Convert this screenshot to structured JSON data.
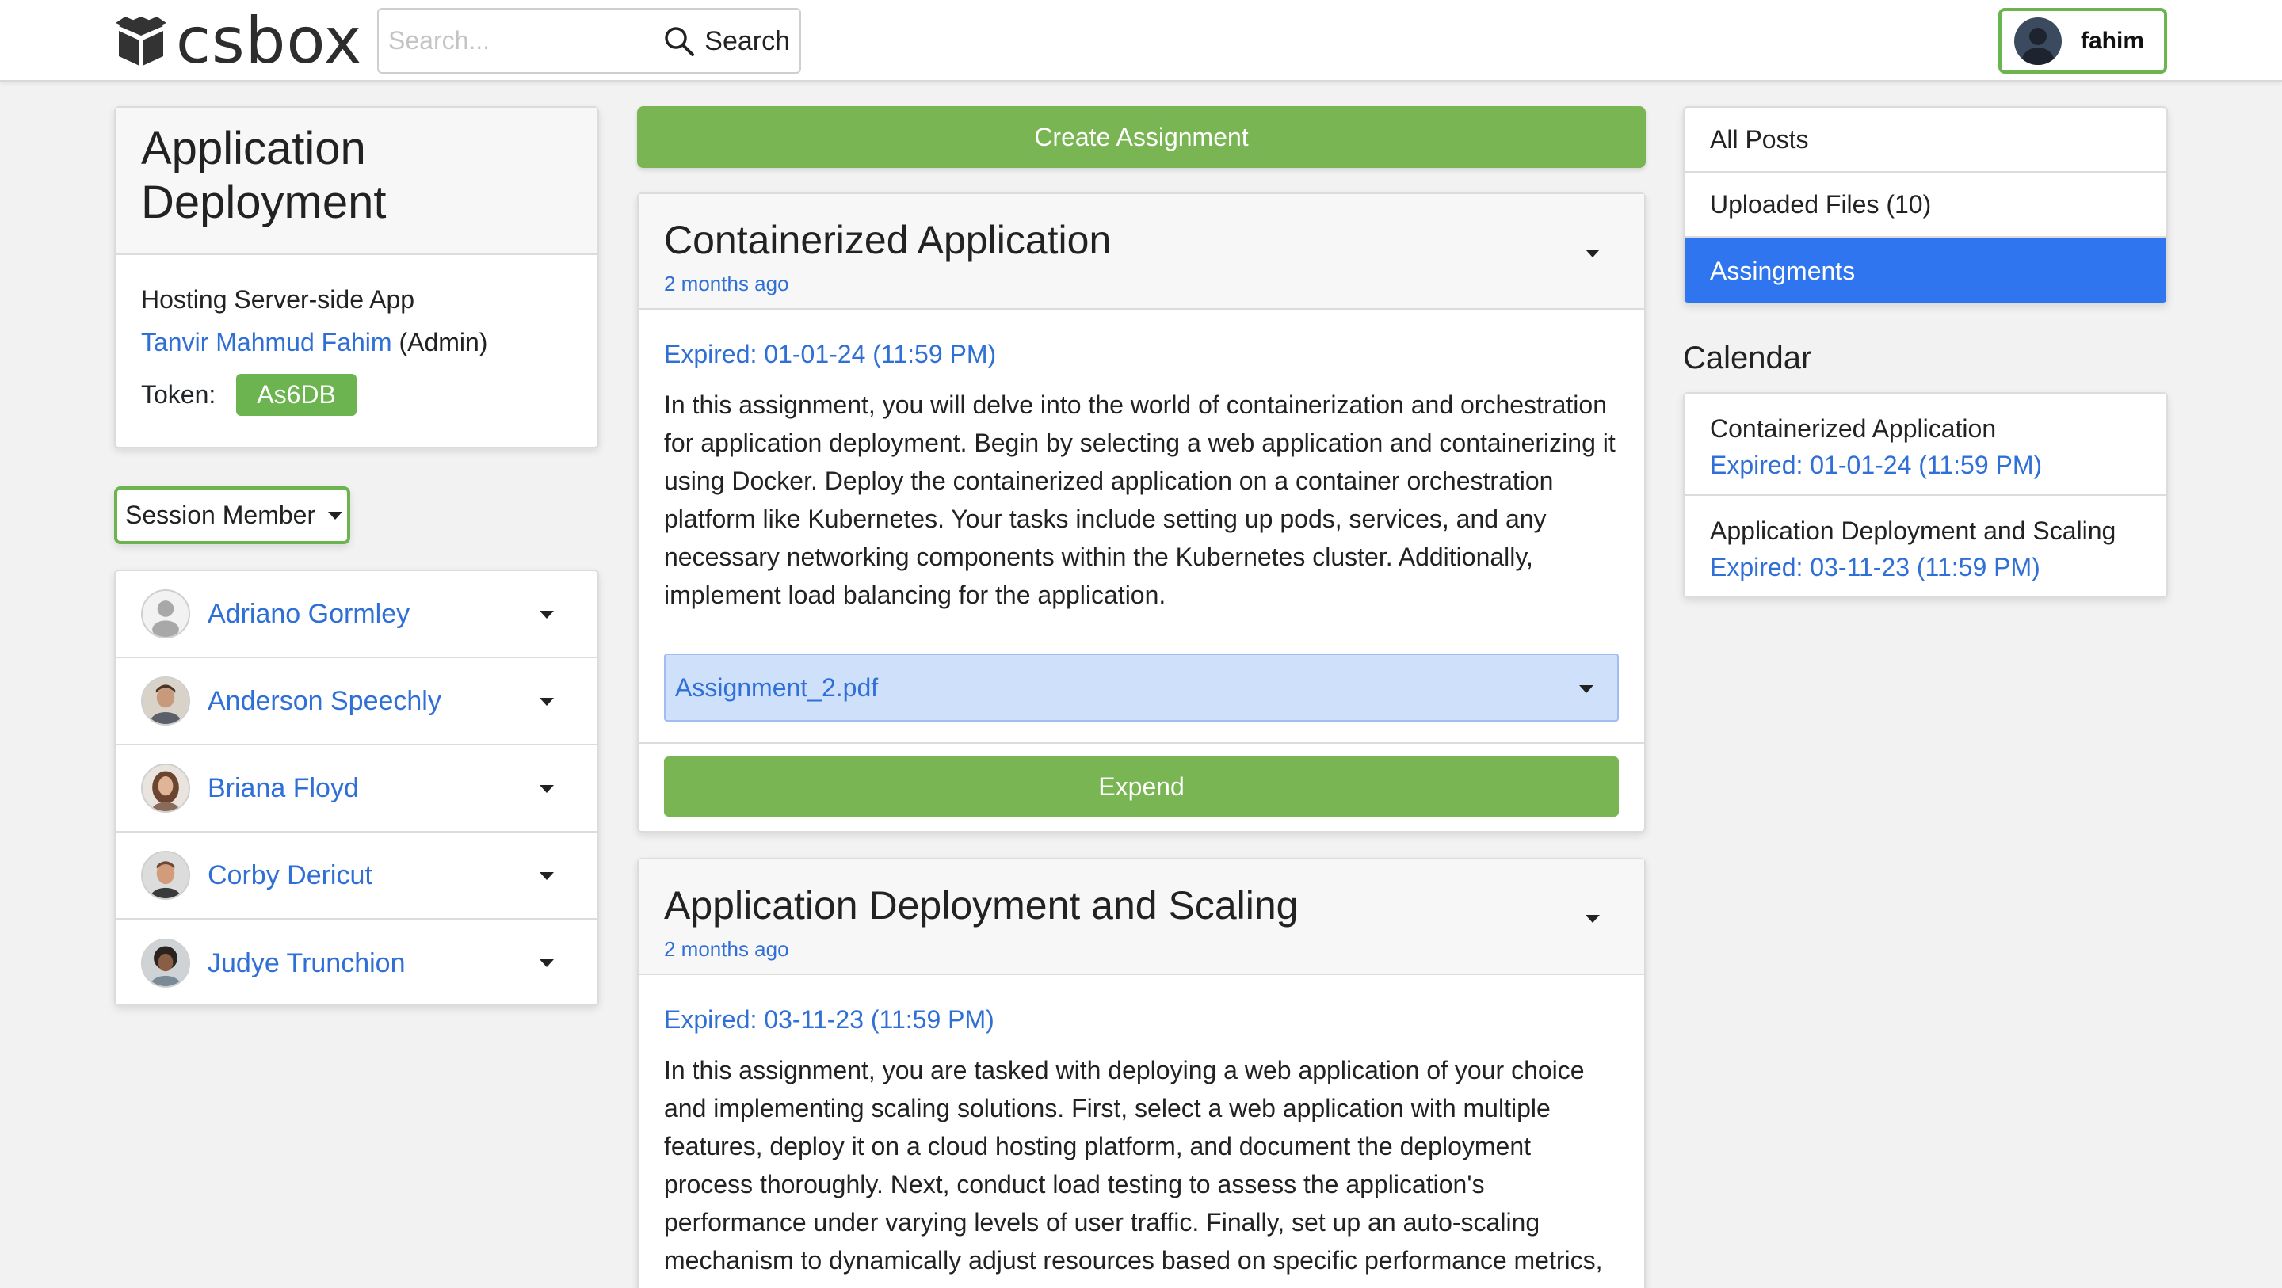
{
  "header": {
    "logo_text": "csbox",
    "search_placeholder": "Search...",
    "search_label": "Search",
    "user_name": "fahim"
  },
  "course": {
    "title": "Application Deployment",
    "subtitle": "Hosting Server-side App",
    "owner_name": "Tanvir Mahmud Fahim",
    "owner_role": "(Admin)",
    "token_label": "Token:",
    "token_value": "As6DB"
  },
  "session": {
    "button_label": "Session Member",
    "members": [
      {
        "name": "Adriano Gormley"
      },
      {
        "name": "Anderson Speechly"
      },
      {
        "name": "Briana Floyd"
      },
      {
        "name": "Corby Dericut"
      },
      {
        "name": "Judye Trunchion"
      }
    ]
  },
  "main": {
    "create_label": "Create Assignment",
    "assignments": [
      {
        "title": "Containerized Application",
        "time": "2 months ago",
        "expired": "Expired: 01-01-24 (11:59 PM)",
        "description": "In this assignment, you will delve into the world of containerization and orchestration for application deployment. Begin by selecting a web application and containerizing it using Docker. Deploy the containerized application on a container orchestration platform like Kubernetes. Your tasks include setting up pods, services, and any necessary networking components within the Kubernetes cluster. Additionally, implement load balancing for the application.",
        "file": "Assignment_2.pdf",
        "action_label": "Expend"
      },
      {
        "title": "Application Deployment and Scaling",
        "time": "2 months ago",
        "expired": "Expired: 03-11-23 (11:59 PM)",
        "description": "In this assignment, you are tasked with deploying a web application of your choice and implementing scaling solutions. First, select a web application with multiple features, deploy it on a cloud hosting platform, and document the deployment process thoroughly. Next, conduct load testing to assess the application's performance under varying levels of user traffic. Finally, set up an auto-scaling mechanism to dynamically adjust resources based on specific performance metrics,"
      }
    ]
  },
  "sidebar": {
    "nav": [
      {
        "label": "All Posts"
      },
      {
        "label": "Uploaded Files (10)"
      },
      {
        "label": "Assingments"
      }
    ],
    "calendar_title": "Calendar",
    "calendar": [
      {
        "name": "Containerized Application",
        "expired": "Expired: 01-01-24 (11:59 PM)"
      },
      {
        "name": "Application Deployment and Scaling",
        "expired": "Expired: 03-11-23 (11:59 PM)"
      }
    ]
  },
  "colors": {
    "accent_green": "#79b653",
    "link_blue": "#2f6fd6",
    "active_blue": "#2f75f0",
    "file_bg": "#cfe0fb"
  }
}
